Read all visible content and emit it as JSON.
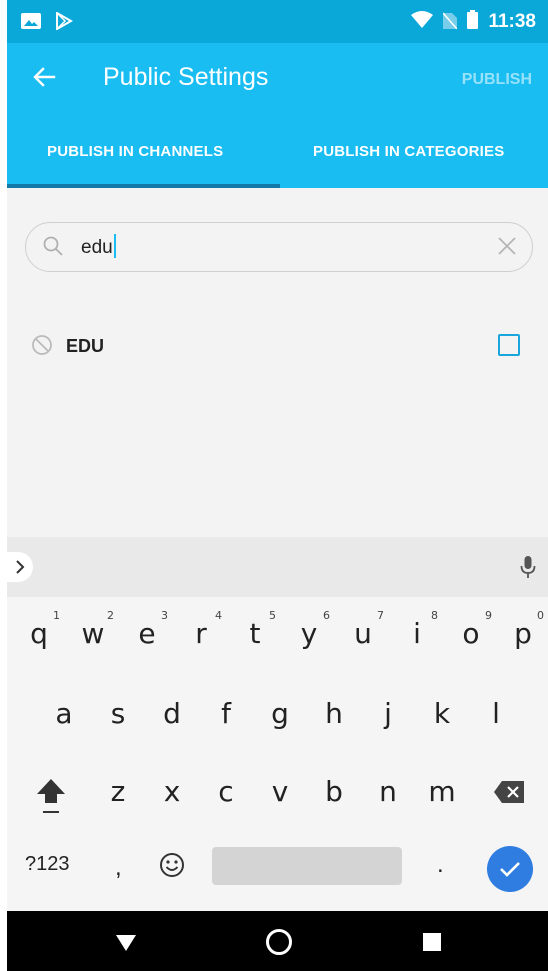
{
  "status_bar": {
    "time": "11:38",
    "left_icons": [
      "image-icon",
      "play-store-icon"
    ],
    "right_icons": [
      "wifi-icon",
      "no-sim-icon",
      "battery-icon"
    ]
  },
  "app_bar": {
    "title": "Public Settings",
    "action": "PUBLISH",
    "tabs": [
      {
        "label": "PUBLISH IN CHANNELS",
        "selected": true
      },
      {
        "label": "PUBLISH IN CATEGORIES",
        "selected": false
      }
    ],
    "colors": {
      "bar": "#19bdf2",
      "status": "#0aa7d9",
      "indicator": "#1379a9"
    }
  },
  "search": {
    "value": "edu"
  },
  "results": [
    {
      "label": "EDU",
      "checked": false
    }
  ],
  "keyboard": {
    "row1": [
      {
        "k": "q",
        "h": "1"
      },
      {
        "k": "w",
        "h": "2"
      },
      {
        "k": "e",
        "h": "3"
      },
      {
        "k": "r",
        "h": "4"
      },
      {
        "k": "t",
        "h": "5"
      },
      {
        "k": "y",
        "h": "6"
      },
      {
        "k": "u",
        "h": "7"
      },
      {
        "k": "i",
        "h": "8"
      },
      {
        "k": "o",
        "h": "9"
      },
      {
        "k": "p",
        "h": "0"
      }
    ],
    "row2": [
      "a",
      "s",
      "d",
      "f",
      "g",
      "h",
      "j",
      "k",
      "l"
    ],
    "row3": [
      "z",
      "x",
      "c",
      "v",
      "b",
      "n",
      "m"
    ],
    "symbols_key": "?123",
    "comma_key": ",",
    "period_key": "."
  }
}
